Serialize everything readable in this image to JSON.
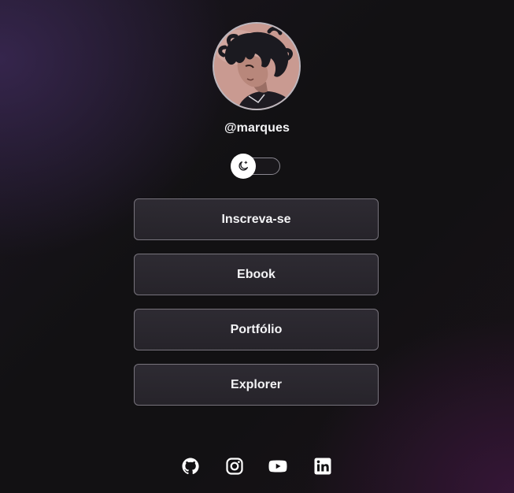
{
  "profile": {
    "username": "@marques"
  },
  "theme_toggle": {
    "icon": "moon-icon"
  },
  "links": [
    {
      "label": "Inscreva-se"
    },
    {
      "label": "Ebook"
    },
    {
      "label": "Portfólio"
    },
    {
      "label": "Explorer"
    }
  ],
  "socials": [
    {
      "icon": "github-icon"
    },
    {
      "icon": "instagram-icon"
    },
    {
      "icon": "youtube-icon"
    },
    {
      "icon": "linkedin-icon"
    }
  ],
  "colors": {
    "background": "#121113",
    "button_border": "#77737c",
    "text": "#f3f3f5"
  }
}
